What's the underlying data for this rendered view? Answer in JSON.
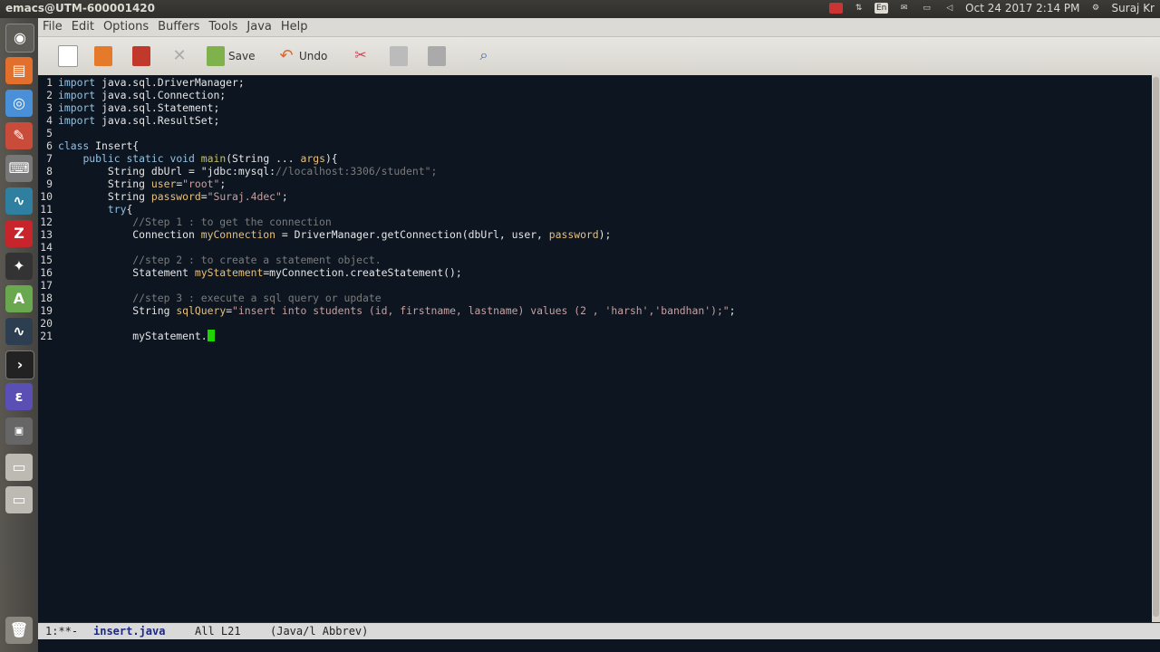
{
  "topbar": {
    "title": "emacs@UTM-600001420",
    "datetime": "Oct 24 2017  2:14 PM",
    "user": "Suraj Kr",
    "lang": "En"
  },
  "menu": [
    "File",
    "Edit",
    "Options",
    "Buffers",
    "Tools",
    "Java",
    "Help"
  ],
  "toolbar": {
    "save": "Save",
    "undo": "Undo"
  },
  "launcher": [
    "ubuntu-icon",
    "files-icon",
    "chrome-icon",
    "settings-icon",
    "keyboard-icon",
    "matlab-icon",
    "filezilla-icon",
    "inkscape-icon",
    "android-studio-icon",
    "system-monitor-icon",
    "terminal-icon",
    "eclipse-icon",
    "workspace-icon",
    "drive-icon",
    "drive-icon",
    "trash-icon"
  ],
  "code": [
    {
      "n": "1",
      "t": "import java.sql.DriverManager;"
    },
    {
      "n": "2",
      "t": "import java.sql.Connection;"
    },
    {
      "n": "3",
      "t": "import java.sql.Statement;"
    },
    {
      "n": "4",
      "t": "import java.sql.ResultSet;"
    },
    {
      "n": "5",
      "t": ""
    },
    {
      "n": "6",
      "t": "class Insert{"
    },
    {
      "n": "7",
      "t": "    public static void main(String ... args){"
    },
    {
      "n": "8",
      "t": "        String dbUrl = \"jdbc:mysql://localhost:3306/student\";"
    },
    {
      "n": "9",
      "t": "        String user=\"root\";"
    },
    {
      "n": "10",
      "t": "        String password=\"Suraj.4dec\";"
    },
    {
      "n": "11",
      "t": "        try{"
    },
    {
      "n": "12",
      "t": "            //Step 1 : to get the connection"
    },
    {
      "n": "13",
      "t": "            Connection myConnection = DriverManager.getConnection(dbUrl, user, password);"
    },
    {
      "n": "14",
      "t": ""
    },
    {
      "n": "15",
      "t": "            //step 2 : to create a statement object."
    },
    {
      "n": "16",
      "t": "            Statement myStatement=myConnection.createStatement();"
    },
    {
      "n": "17",
      "t": ""
    },
    {
      "n": "18",
      "t": "            //step 3 : execute a sql query or update"
    },
    {
      "n": "19",
      "t": "            String sqlQuery=\"insert into students (id, firstname, lastname) values (2 , 'harsh','bandhan');\";"
    },
    {
      "n": "20",
      "t": ""
    },
    {
      "n": "21",
      "t": "            myStatement."
    }
  ],
  "modeline": {
    "status": "1:**-",
    "buffer": "insert.java",
    "position": "All L21",
    "mode": "(Java/l Abbrev)"
  }
}
